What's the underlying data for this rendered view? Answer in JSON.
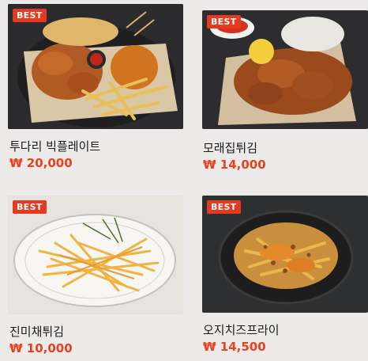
{
  "badge_label": "BEST",
  "items": [
    {
      "name": "투다리 빅플레이트",
      "price": "₩ 20,000"
    },
    {
      "name": "모래집튀김",
      "price": "₩ 14,000"
    },
    {
      "name": "진미채튀김",
      "price": "₩ 10,000"
    },
    {
      "name": "오지치즈프라이",
      "price": "₩ 14,500"
    }
  ],
  "colors": {
    "badge": "#e43a1f",
    "price": "#e8421f",
    "background": "#ecebea"
  }
}
